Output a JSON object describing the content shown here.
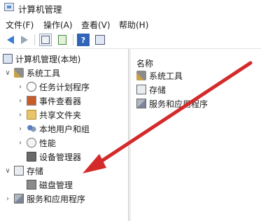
{
  "window": {
    "title": "计算机管理"
  },
  "menu": [
    "文件(F)",
    "操作(A)",
    "查看(V)",
    "帮助(H)"
  ],
  "tree": {
    "root": "计算机管理(本地)",
    "system_tools": "系统工具",
    "task_scheduler": "任务计划程序",
    "event_viewer": "事件查看器",
    "shared_folders": "共享文件夹",
    "local_users": "本地用户和组",
    "performance": "性能",
    "device_manager": "设备管理器",
    "storage": "存储",
    "disk_management": "磁盘管理",
    "services_apps": "服务和应用程序"
  },
  "right_pane": {
    "header": "名称",
    "items": [
      "系统工具",
      "存储",
      "服务和应用程序"
    ]
  },
  "colors": {
    "arrow": "#d42a2a",
    "back_arrow": "#3a7bd5"
  }
}
